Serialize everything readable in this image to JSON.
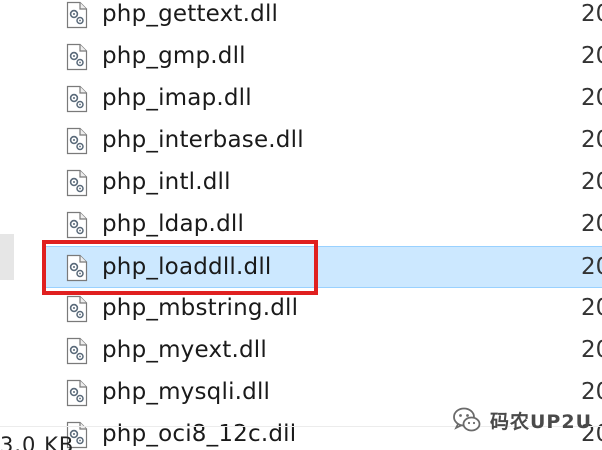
{
  "file_list": {
    "rows": [
      {
        "name": "php_gettext.dll",
        "date": "20",
        "selected": false
      },
      {
        "name": "php_gmp.dll",
        "date": "20",
        "selected": false
      },
      {
        "name": "php_imap.dll",
        "date": "20",
        "selected": false
      },
      {
        "name": "php_interbase.dll",
        "date": "20",
        "selected": false
      },
      {
        "name": "php_intl.dll",
        "date": "20",
        "selected": false
      },
      {
        "name": "php_ldap.dll",
        "date": "20",
        "selected": false
      },
      {
        "name": "php_loaddll.dll",
        "date": "20",
        "selected": true
      },
      {
        "name": "php_mbstring.dll",
        "date": "20",
        "selected": false
      },
      {
        "name": "php_myext.dll",
        "date": "20",
        "selected": false
      },
      {
        "name": "php_mysqli.dll",
        "date": "20",
        "selected": false
      },
      {
        "name": "php_oci8_12c.dll",
        "date": "20",
        "selected": false
      }
    ],
    "icon": "dll-file-gear-icon"
  },
  "status_bar": {
    "size_text": "3.0 KB"
  },
  "watermark": {
    "text": "码农UP2U",
    "icon": "wechat-logo-icon"
  },
  "colors": {
    "selection_bg": "#cce8ff",
    "selection_border": "#99d1ff",
    "annotation_box": "#e02020"
  }
}
